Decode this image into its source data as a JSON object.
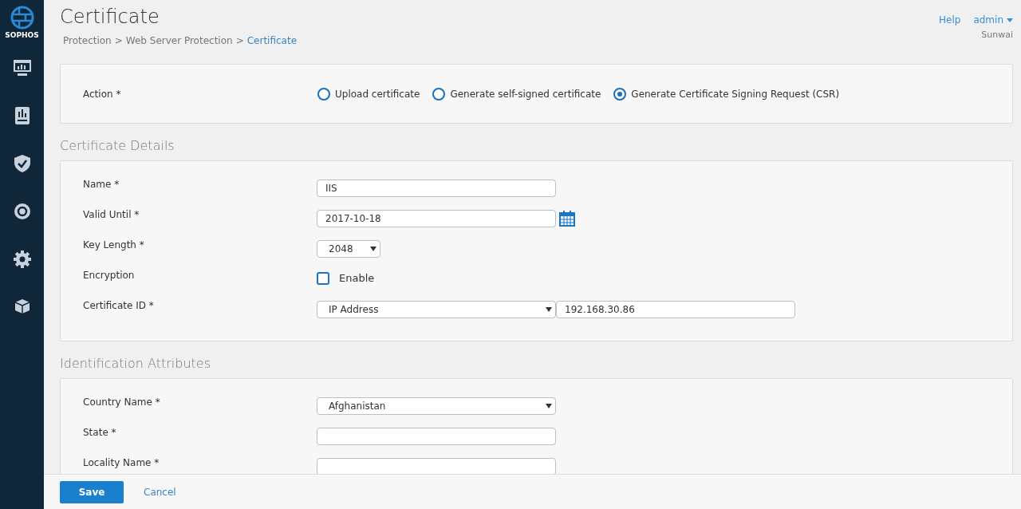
{
  "brand": {
    "name": "SOPHOS"
  },
  "sidebar": {
    "items": [
      {
        "kind": "monitor"
      },
      {
        "kind": "report"
      },
      {
        "kind": "shield"
      },
      {
        "kind": "target"
      },
      {
        "kind": "gear"
      },
      {
        "kind": "box"
      }
    ]
  },
  "header": {
    "title": "Certificate",
    "breadcrumb": [
      {
        "label": "Protection",
        "current": false
      },
      {
        "label": "Web Server Protection",
        "current": false
      },
      {
        "label": "Certificate",
        "current": true
      }
    ],
    "separator": ">",
    "help": "Help",
    "user": "admin",
    "org": "Sunwai"
  },
  "action": {
    "label": "Action *",
    "options": [
      {
        "label": "Upload certificate",
        "selected": false
      },
      {
        "label": "Generate self-signed certificate",
        "selected": false
      },
      {
        "label": "Generate Certificate Signing Request (CSR)",
        "selected": true
      }
    ]
  },
  "sections": [
    {
      "title": "Certificate Details",
      "rows": [
        {
          "kind": "text",
          "label": "Name *",
          "value": "IIS"
        },
        {
          "kind": "date",
          "label": "Valid Until *",
          "value": "2017-10-18"
        },
        {
          "kind": "select_small",
          "label": "Key Length *",
          "value": "2048"
        },
        {
          "kind": "checkbox",
          "label": "Encryption",
          "option": "Enable",
          "checked": false
        },
        {
          "kind": "select_text",
          "label": "Certificate ID *",
          "value": "IP Address",
          "value2": "192.168.30.86"
        }
      ]
    },
    {
      "title": "Identification Attributes",
      "rows": [
        {
          "kind": "select",
          "label": "Country Name *",
          "value": "Afghanistan"
        },
        {
          "kind": "text",
          "label": "State *",
          "value": ""
        },
        {
          "kind": "text",
          "label": "Locality Name *",
          "value": ""
        }
      ]
    }
  ],
  "footer": {
    "save": "Save",
    "cancel": "Cancel"
  }
}
